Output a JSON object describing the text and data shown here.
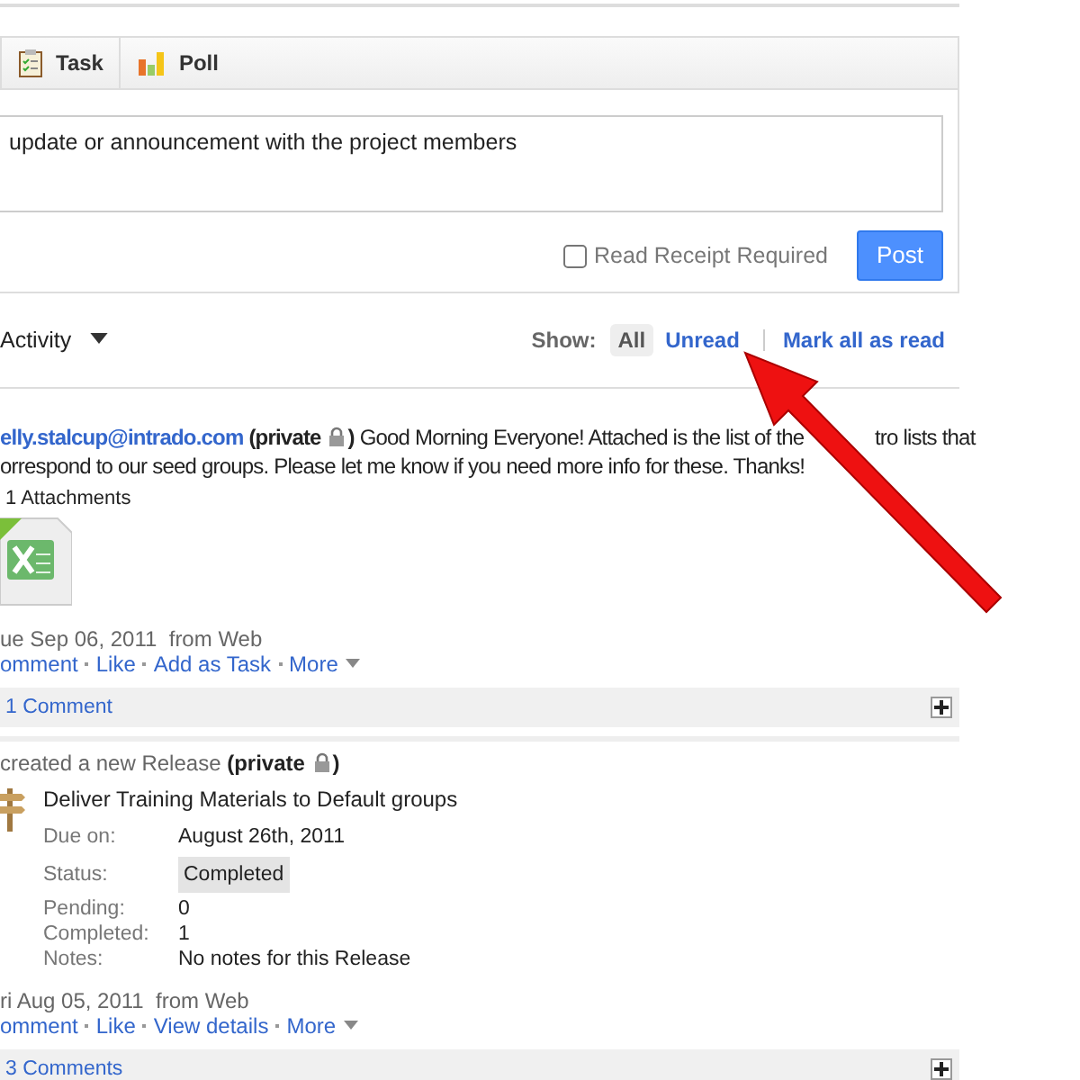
{
  "composer": {
    "tabs": [
      {
        "label": "Task",
        "selected": false
      },
      {
        "label": "Poll",
        "selected": false
      }
    ],
    "message": {
      "placeholder": "update or announcement with the project members"
    },
    "read_receipt": {
      "label": "Read Receipt Required",
      "checked": false
    },
    "post_button": "Post"
  },
  "feed_header": {
    "filter": "Activity",
    "show_label": "Show:",
    "options": [
      {
        "label": "All",
        "selected": true
      },
      {
        "label": "Unread",
        "selected": false
      }
    ],
    "mark_all": "Mark all as read"
  },
  "posts": [
    {
      "kind": "message",
      "author": "elly.stalcup@intrado.com",
      "privacy": "(private",
      "privacy_end": ")",
      "body": [
        "Good Morning Everyone! Attached is the list of the",
        "tro lists that",
        "orrespond to our seed groups. Please let me know if you need more info for these. Thanks!"
      ],
      "attachments_label": "1 Attachments",
      "date": "ue Sep 06, 2011  from Web",
      "actions": [
        "omment",
        "Like",
        "Add as Task",
        "More"
      ],
      "comments": "1 Comment"
    },
    {
      "kind": "release",
      "author": "created a new Release",
      "privacy": "(private",
      "privacy_end": ")",
      "title": "Deliver Training Materials to Default groups",
      "fields": [
        {
          "label": "Due on:",
          "value": "August 26th, 2011",
          "kind": "text"
        },
        {
          "label": "Status:",
          "value": "Completed",
          "kind": "status"
        },
        {
          "label": "Pending:",
          "value": "0",
          "kind": "text"
        },
        {
          "label": "Completed:",
          "value": "1",
          "kind": "text"
        },
        {
          "label": "Notes:",
          "value": "No notes for this Release",
          "kind": "text"
        }
      ],
      "date": "ri Aug 05, 2011  from Web",
      "actions": [
        "omment",
        "Like",
        "View details",
        "More"
      ],
      "comments": "3 Comments"
    }
  ]
}
